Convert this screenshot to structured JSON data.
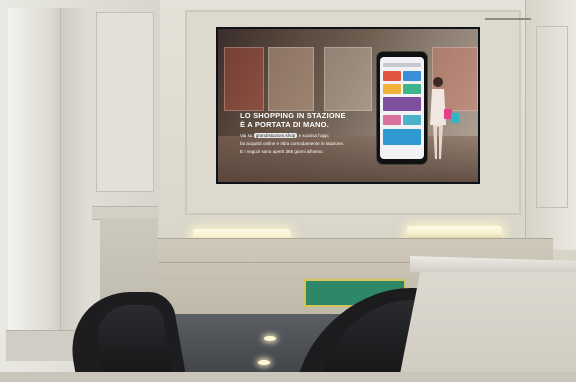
{
  "ad": {
    "headline_line1": "LO SHOPPING IN STAZIONE",
    "headline_line2": "È A PORTATA DI MANO.",
    "line1_before": "Vai su",
    "line1_highlight": "grandistazioni.shop",
    "line1_after": "e scarica l'app;",
    "line2": "fai acquisti online e ritira comodamente in stazione.",
    "line3": "E i negozi sono aperti 365 giorni all'anno."
  },
  "colors": {
    "screen_dark": "#1b2230",
    "panel_green": "#2e8766",
    "lamp_glow": "#fffbe8"
  }
}
